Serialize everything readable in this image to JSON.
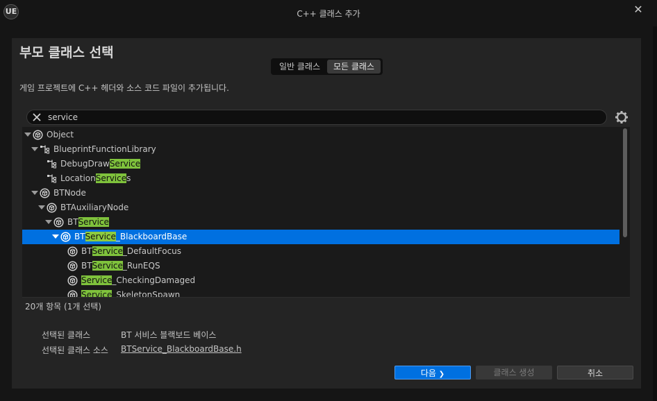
{
  "window": {
    "title": "C++ 클래스 추가",
    "logo": "UE"
  },
  "heading": "부모 클래스 선택",
  "toggle": {
    "general": "일반 클래스",
    "all": "모든 클래스"
  },
  "description": "게임 프로젝트에 C++ 헤더와 소스 코드 파일이 추가됩니다.",
  "search": {
    "value": "service",
    "placeholder": ""
  },
  "tree": [
    {
      "pre": "",
      "hl": "",
      "post": "Object",
      "icon": "class-icon",
      "expanded": true
    },
    {
      "pre": "",
      "hl": "",
      "post": "BlueprintFunctionLibrary",
      "icon": "library-icon",
      "expanded": true
    },
    {
      "pre": "DebugDraw",
      "hl": "Service",
      "post": "",
      "icon": "library-icon",
      "expanded": false
    },
    {
      "pre": "Location",
      "hl": "Service",
      "post": "s",
      "icon": "library-icon",
      "expanded": false
    },
    {
      "pre": "",
      "hl": "",
      "post": "BTNode",
      "icon": "class-icon",
      "expanded": true
    },
    {
      "pre": "",
      "hl": "",
      "post": "BTAuxiliaryNode",
      "icon": "class-icon",
      "expanded": true
    },
    {
      "pre": "BT",
      "hl": "Service",
      "post": "",
      "icon": "class-icon",
      "expanded": true
    },
    {
      "pre": "BT",
      "hl": "Service",
      "post": "_BlackboardBase",
      "icon": "class-icon",
      "expanded": true,
      "selected": true
    },
    {
      "pre": "BT",
      "hl": "Service",
      "post": "_DefaultFocus",
      "icon": "class-icon",
      "expanded": false
    },
    {
      "pre": "BT",
      "hl": "Service",
      "post": "_RunEQS",
      "icon": "class-icon",
      "expanded": false
    },
    {
      "pre": "",
      "hl": "Service",
      "post": "_CheckingDamaged",
      "icon": "class-icon",
      "expanded": false
    },
    {
      "pre": "",
      "hl": "Service",
      "post": "_SkeletonSpawn",
      "icon": "class-icon",
      "expanded": false
    }
  ],
  "item_count": "20개 항목 (1개 선택)",
  "selected_class": {
    "label": "선택된 클래스",
    "value": "BT 서비스 블랙보드 베이스"
  },
  "selected_source": {
    "label": "선택된 클래스 소스",
    "value": "BTService_BlackboardBase.h"
  },
  "buttons": {
    "next": "다음",
    "next_glyph": "❯",
    "create": "클래스 생성",
    "cancel": "취소"
  },
  "colors": {
    "accent": "#0070e0",
    "highlight": "#7fc23c"
  }
}
